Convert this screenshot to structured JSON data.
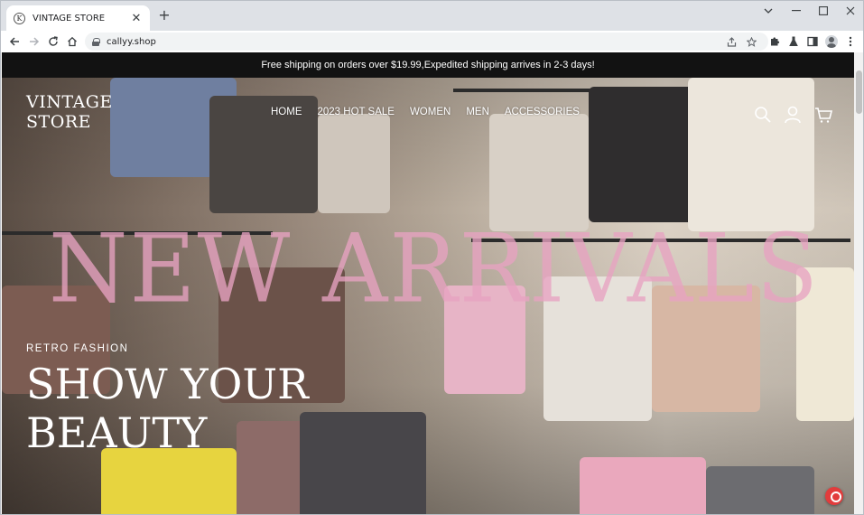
{
  "browser": {
    "tab_title": "VINTAGE STORE",
    "favicon_letter": "K",
    "new_tab": "+",
    "url": "callyy.shop"
  },
  "announcement": "Free shipping on orders over $19.99,Expedited shipping arrives in 2-3 days!",
  "header": {
    "logo_line1": "VINTAGE",
    "logo_line2": "STORE",
    "nav": [
      "HOME",
      "2023 HOT SALE",
      "WOMEN",
      "MEN",
      "ACCESSORIES"
    ]
  },
  "hero": {
    "headline": "NEW ARRIVALS",
    "kicker": "RETRO FASHION",
    "title_line1": "SHOW YOUR",
    "title_line2": "BEAUTY"
  },
  "colors": {
    "headline_pink": "#e8a3c2",
    "announcement_bg": "#121212",
    "chat_button": "#e23c3c"
  }
}
